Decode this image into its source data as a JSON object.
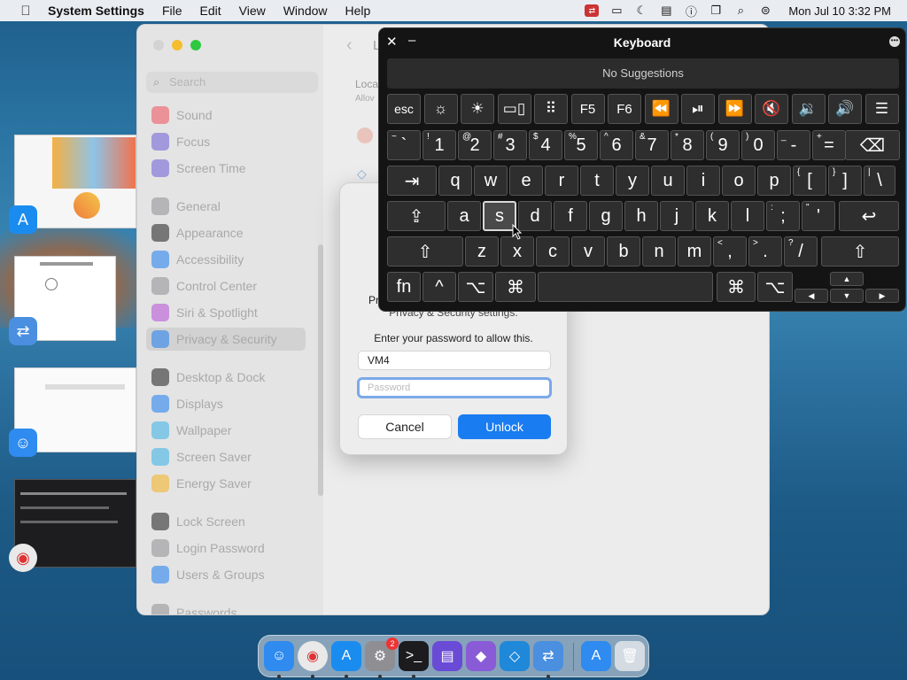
{
  "menubar": {
    "app_name": "System Settings",
    "menus": [
      "File",
      "Edit",
      "View",
      "Window",
      "Help"
    ],
    "clock": "Mon Jul 10  3:32 PM"
  },
  "settings": {
    "search_placeholder": "Search",
    "sidebar": [
      {
        "label": "Sound",
        "color": "#ef4e58"
      },
      {
        "label": "Focus",
        "color": "#6b5bd6"
      },
      {
        "label": "Screen Time",
        "color": "#6b5bd6"
      },
      {
        "label": "General",
        "color": "#8e8e93"
      },
      {
        "label": "Appearance",
        "color": "#1c1c1e"
      },
      {
        "label": "Accessibility",
        "color": "#1a7cf1"
      },
      {
        "label": "Control Center",
        "color": "#8e8e93"
      },
      {
        "label": "Siri & Spotlight",
        "color": "#b44bd6"
      },
      {
        "label": "Privacy & Security",
        "color": "#1a7cf1"
      },
      {
        "label": "Desktop & Dock",
        "color": "#1c1c1e"
      },
      {
        "label": "Displays",
        "color": "#1a7cf1"
      },
      {
        "label": "Wallpaper",
        "color": "#35b0e8"
      },
      {
        "label": "Screen Saver",
        "color": "#35b0e8"
      },
      {
        "label": "Energy Saver",
        "color": "#f2b01e"
      },
      {
        "label": "Lock Screen",
        "color": "#1c1c1e"
      },
      {
        "label": "Login Password",
        "color": "#8e8e93"
      },
      {
        "label": "Users & Groups",
        "color": "#1a7cf1"
      },
      {
        "label": "Passwords",
        "color": "#8e8e93"
      }
    ],
    "content_title": "L",
    "content_header": "Loca",
    "content_sub": "Allov"
  },
  "dialog": {
    "partial_line1": "Pr",
    "partial_line2": "Privacy & Security settings.",
    "prompt": "Enter your password to allow this.",
    "username": "VM4",
    "password_placeholder": "Password",
    "cancel": "Cancel",
    "unlock": "Unlock"
  },
  "keyboard": {
    "title": "Keyboard",
    "suggestions": "No Suggestions",
    "fn_row": [
      {
        "label": "esc",
        "icon": "esc-key"
      },
      {
        "label": "☼",
        "icon": "brightness-down-icon"
      },
      {
        "label": "☀",
        "icon": "brightness-up-icon"
      },
      {
        "label": "▭▯",
        "icon": "mission-control-icon"
      },
      {
        "label": "⠿",
        "icon": "launchpad-icon"
      },
      {
        "label": "F5",
        "icon": "f5-key"
      },
      {
        "label": "F6",
        "icon": "f6-key"
      },
      {
        "label": "⏪",
        "icon": "rewind-icon"
      },
      {
        "label": "⏯",
        "icon": "play-pause-icon"
      },
      {
        "label": "⏩",
        "icon": "fast-forward-icon"
      },
      {
        "label": "🔇",
        "icon": "mute-icon"
      },
      {
        "label": "🔉",
        "icon": "volume-down-icon"
      },
      {
        "label": "🔊",
        "icon": "volume-up-icon"
      },
      {
        "label": "☰",
        "icon": "list-icon"
      }
    ],
    "number_row": [
      {
        "main": "`",
        "shift": "~"
      },
      {
        "main": "1",
        "shift": "!"
      },
      {
        "main": "2",
        "shift": "@"
      },
      {
        "main": "3",
        "shift": "#"
      },
      {
        "main": "4",
        "shift": "$"
      },
      {
        "main": "5",
        "shift": "%"
      },
      {
        "main": "6",
        "shift": "^"
      },
      {
        "main": "7",
        "shift": "&"
      },
      {
        "main": "8",
        "shift": "*"
      },
      {
        "main": "9",
        "shift": "("
      },
      {
        "main": "0",
        "shift": ")"
      },
      {
        "main": "-",
        "shift": "_"
      },
      {
        "main": "=",
        "shift": "+"
      },
      {
        "main": "⌫",
        "shift": ""
      }
    ],
    "qwerty_row": [
      {
        "main": "⇥",
        "shift": ""
      },
      {
        "main": "q",
        "shift": ""
      },
      {
        "main": "w",
        "shift": ""
      },
      {
        "main": "e",
        "shift": ""
      },
      {
        "main": "r",
        "shift": ""
      },
      {
        "main": "t",
        "shift": ""
      },
      {
        "main": "y",
        "shift": ""
      },
      {
        "main": "u",
        "shift": ""
      },
      {
        "main": "i",
        "shift": ""
      },
      {
        "main": "o",
        "shift": ""
      },
      {
        "main": "p",
        "shift": ""
      },
      {
        "main": "[",
        "shift": "{"
      },
      {
        "main": "]",
        "shift": "}"
      },
      {
        "main": "\\",
        "shift": "|"
      }
    ],
    "home_row": [
      {
        "main": "⇪",
        "shift": ""
      },
      {
        "main": "a",
        "shift": ""
      },
      {
        "main": "s",
        "shift": ""
      },
      {
        "main": "d",
        "shift": ""
      },
      {
        "main": "f",
        "shift": ""
      },
      {
        "main": "g",
        "shift": ""
      },
      {
        "main": "h",
        "shift": ""
      },
      {
        "main": "j",
        "shift": ""
      },
      {
        "main": "k",
        "shift": ""
      },
      {
        "main": "l",
        "shift": ""
      },
      {
        "main": ";",
        "shift": ":"
      },
      {
        "main": "'",
        "shift": "\""
      },
      {
        "main": "↩",
        "shift": ""
      }
    ],
    "shift_row": [
      {
        "main": "⇧",
        "shift": ""
      },
      {
        "main": "z",
        "shift": ""
      },
      {
        "main": "x",
        "shift": ""
      },
      {
        "main": "c",
        "shift": ""
      },
      {
        "main": "v",
        "shift": ""
      },
      {
        "main": "b",
        "shift": ""
      },
      {
        "main": "n",
        "shift": ""
      },
      {
        "main": "m",
        "shift": ""
      },
      {
        "main": ",",
        "shift": "<"
      },
      {
        "main": ".",
        "shift": ">"
      },
      {
        "main": "/",
        "shift": "?"
      },
      {
        "main": "⇧",
        "shift": ""
      }
    ],
    "bottom_row": [
      {
        "main": "fn"
      },
      {
        "main": "^"
      },
      {
        "main": "⌥"
      },
      {
        "main": "⌘"
      },
      {
        "main": ""
      },
      {
        "main": "⌘"
      },
      {
        "main": "⌥"
      }
    ],
    "arrows": {
      "up": "▲",
      "down": "▼",
      "left": "◀",
      "right": "▶"
    },
    "selected_key": "s"
  },
  "dock": {
    "apps": [
      {
        "name": "finder-icon",
        "color": "#2f8bef",
        "glyph": "☺",
        "running": true
      },
      {
        "name": "chrome-icon",
        "color": "#e9e9e9",
        "glyph": "◉",
        "running": true
      },
      {
        "name": "app-store-icon",
        "color": "#1a8cf0",
        "glyph": "A",
        "running": true
      },
      {
        "name": "system-settings-icon",
        "color": "#8e8e93",
        "glyph": "⚙",
        "running": true,
        "badge": "2"
      },
      {
        "name": "terminal-icon",
        "color": "#1c1c1e",
        "glyph": ">_",
        "running": true
      },
      {
        "name": "notes-icon",
        "color": "#6a4bd6",
        "glyph": "▤",
        "running": false
      },
      {
        "name": "visual-studio-icon",
        "color": "#8a5bd6",
        "glyph": "◆",
        "running": false
      },
      {
        "name": "vscode-icon",
        "color": "#1f88d9",
        "glyph": "◇",
        "running": false
      },
      {
        "name": "migration-icon",
        "color": "#4a8fe0",
        "glyph": "⇄",
        "running": true
      }
    ],
    "extras": [
      {
        "name": "downloads-icon",
        "color": "#2f8bef",
        "glyph": "A"
      },
      {
        "name": "trash-icon",
        "color": "#d4dbe2",
        "glyph": "🗑"
      }
    ]
  }
}
